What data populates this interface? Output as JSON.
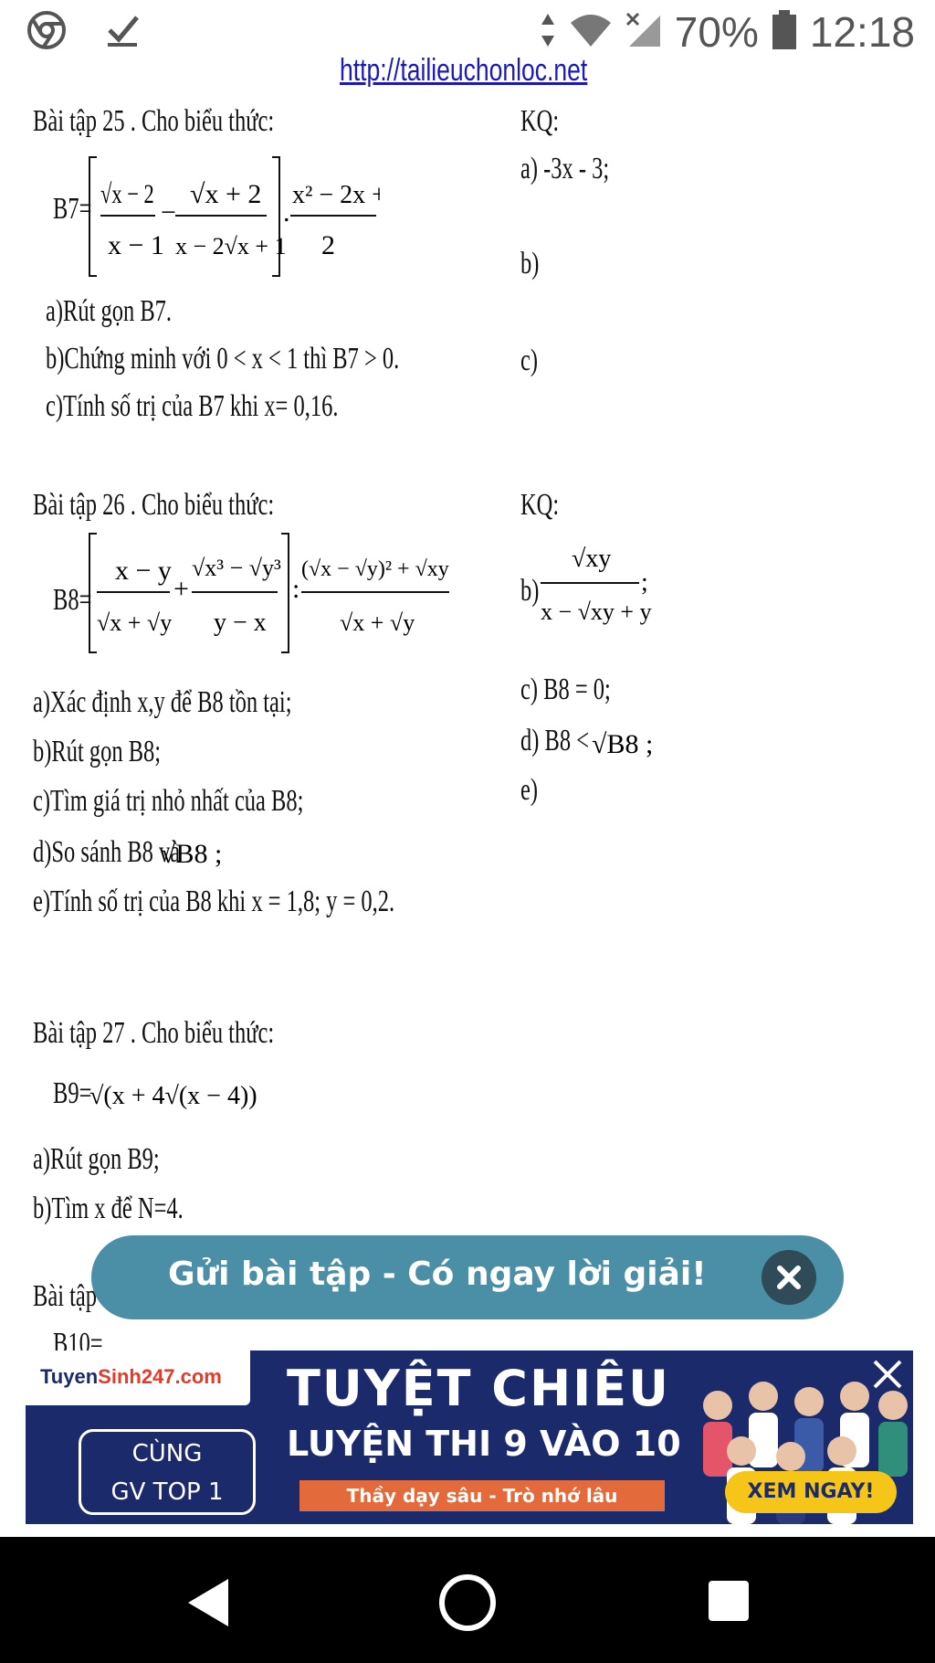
{
  "status_bar": {
    "battery": "70%",
    "time": "12:18",
    "icons": [
      "chrome-icon",
      "check-icon",
      "data-arrows-icon",
      "wifi-icon",
      "no-signal-icon",
      "battery-icon"
    ]
  },
  "document": {
    "url_text": "http://tailieuchonloc.net",
    "ex25": {
      "title": "Bài tập 25 . Cho biểu thức:",
      "kq": "KQ:",
      "ans_a": "a) -3x - 3;",
      "ans_b": "b)",
      "ans_c": "c)",
      "formula_label": "B7=",
      "q_a": "a)Rút gọn B7.",
      "q_b": "b)Chứng minh  với 0 < x < 1 thì B7 > 0.",
      "q_c": "c)Tính số trị  của B7 khi x= 0,16."
    },
    "ex26": {
      "title": "Bài tập 26 . Cho biểu thức:",
      "kq": "KQ:",
      "ans_b": "b)",
      "ans_c": "c) B8 = 0;",
      "ans_d": "d) B8 <",
      "ans_e": "e)",
      "formula_label": "B8=",
      "q_a": "a)Xác định x,y để B8 tồn tại;",
      "q_b": "b)Rút gọn B8;",
      "q_c": "c)Tìm giá trị nhỏ nhất của B8;",
      "q_d": "d)So sánh B8 và",
      "q_e": "e)Tính số trị của B8 khi x = 1,8; y = 0,2."
    },
    "ex27": {
      "title": "Bài tập 27 . Cho biểu thức:",
      "formula_label": "B9=",
      "q_a": "a)Rút gọn B9;",
      "q_b": "b)Tìm x để N=4."
    },
    "ex28_partial": {
      "title": "Bài tập 2",
      "formula_label": "B10="
    }
  },
  "floating_pill": {
    "label": "Gửi bài tập - Có ngay lời giải!"
  },
  "ad": {
    "logo_prefix": "Tuyen",
    "logo_brand": "Sinh247.com",
    "left_line1": "CÙNG",
    "left_line2": "GV TOP 1",
    "headline1": "TUYỆT CHIÊU",
    "headline2": "LUYỆN THI 9 VÀO 10",
    "tagline": "Thầy dạy sâu - Trò nhớ lâu",
    "cta": "XEM NGAY!"
  },
  "colors": {
    "pill": "#4a8fa6",
    "ad_bg": "#1b2a6b",
    "cta": "#f5c518",
    "nav_bg": "#000000"
  }
}
